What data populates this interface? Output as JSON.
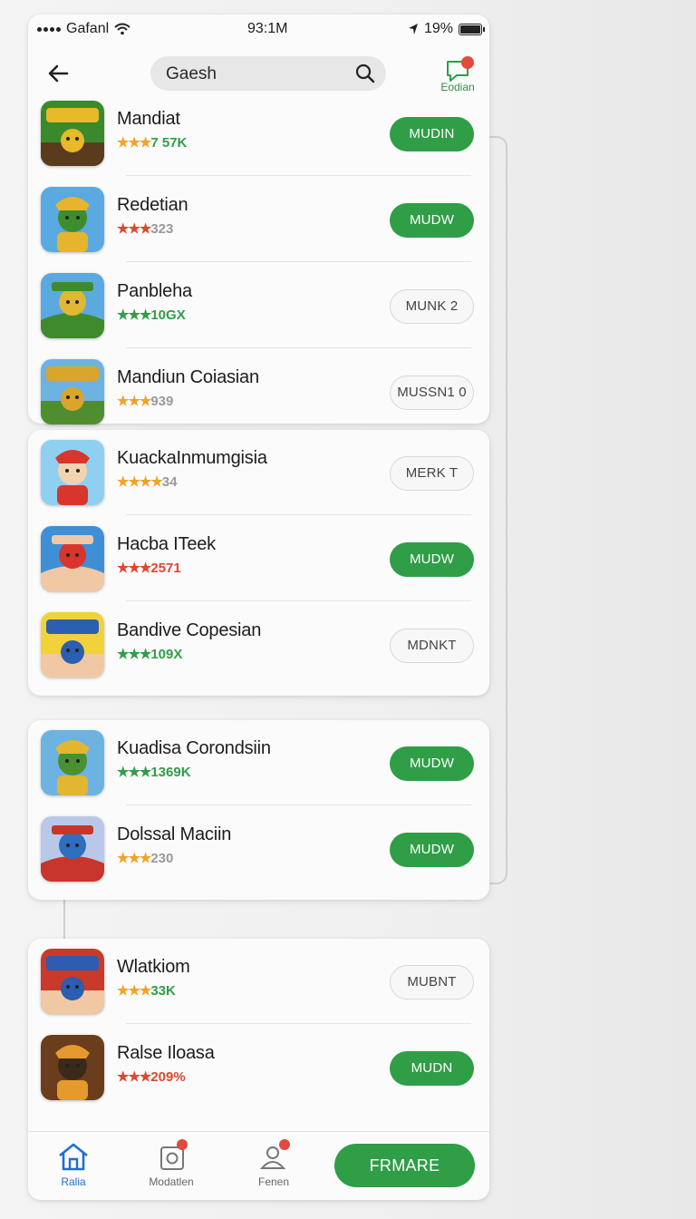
{
  "status_bar": {
    "carrier": "Gafanl",
    "time": "93:1M",
    "battery": "19%"
  },
  "header": {
    "search_text": "Gaesh",
    "notify_label": "Eodian"
  },
  "apps": [
    {
      "name": "Mandiat",
      "stars": "★★★",
      "count": "7 57K",
      "button": "MUDIN",
      "button_style": "green",
      "star_color": "#f0a32a",
      "count_color": "#2f9e46",
      "icon_colors": [
        "#3a8a2c",
        "#e8b928",
        "#5b3b1e"
      ]
    },
    {
      "name": "Redetian",
      "stars": "★★★",
      "count": "323",
      "button": "MUDW",
      "button_style": "green",
      "star_color": "#e0472f",
      "count_color": "#9a9a9a",
      "icon_colors": [
        "#5aa9e0",
        "#e6b52c",
        "#3e8d2d"
      ]
    },
    {
      "name": "Panbleha",
      "stars": "★★★",
      "count": "10GX",
      "button": "MUNK 2",
      "button_style": "outline",
      "star_color": "#2f9e46",
      "count_color": "#2f9e46",
      "icon_colors": [
        "#5aa9e0",
        "#e0b833",
        "#3f8a2c"
      ]
    },
    {
      "name": "Mandiun Coiasian",
      "stars": "★★★",
      "count": "939",
      "button": "MUSSN1 0",
      "button_style": "outline",
      "star_color": "#f0a32a",
      "count_color": "#9a9a9a",
      "icon_colors": [
        "#6cb3e2",
        "#d9a52b",
        "#4f8e30"
      ]
    },
    {
      "name": "KuackaInmumgisia",
      "stars": "★★★★",
      "count": "34",
      "button": "MERK T",
      "button_style": "outline",
      "star_color": "#f0a32a",
      "count_color": "#9a9a9a",
      "icon_colors": [
        "#8fd0f0",
        "#d8362d",
        "#f2d3b0"
      ]
    },
    {
      "name": "Hacba ITeek",
      "stars": "★★★",
      "count": "2571",
      "button": "MUDW",
      "button_style": "green",
      "star_color": "#e0472f",
      "count_color": "#e0472f",
      "icon_colors": [
        "#3f8fd6",
        "#d8362d",
        "#f0c9a4"
      ]
    },
    {
      "name": "Bandive Copesian",
      "stars": "★★★",
      "count": "109X",
      "button": "MDNKT",
      "button_style": "outline",
      "star_color": "#2f9e46",
      "count_color": "#2f9e46",
      "icon_colors": [
        "#f2d23a",
        "#2b5fb0",
        "#f0c9a4"
      ]
    },
    {
      "name": "Kuadisa Corondsiin",
      "stars": "★★★",
      "count": "1369K",
      "button": "MUDW",
      "button_style": "green",
      "star_color": "#2f9e46",
      "count_color": "#2f9e46",
      "icon_colors": [
        "#6cb3e2",
        "#e1b630",
        "#4a9032"
      ]
    },
    {
      "name": "Dolssal Maciin",
      "stars": "★★★",
      "count": "230",
      "button": "MUDW",
      "button_style": "green",
      "star_color": "#f0a32a",
      "count_color": "#9a9a9a",
      "icon_colors": [
        "#b9c8e8",
        "#2d6fc0",
        "#c8352c"
      ]
    },
    {
      "name": "Wlatkiom",
      "stars": "★★★",
      "count": "33K",
      "button": "MUBNT",
      "button_style": "outline",
      "star_color": "#f0a32a",
      "count_color": "#2f9e46",
      "icon_colors": [
        "#c83a2a",
        "#2d5cb0",
        "#f0c9a4"
      ]
    },
    {
      "name": "Ralse Iloasa",
      "stars": "★★★",
      "count": "209%",
      "button": "MUDN",
      "button_style": "green",
      "star_color": "#e0472f",
      "count_color": "#e0472f",
      "icon_colors": [
        "#6a3d1c",
        "#e69a2e",
        "#3b2a1a"
      ]
    }
  ],
  "tabbar": {
    "tabs": [
      {
        "label": "Ralia",
        "active": true
      },
      {
        "label": "Modatlen",
        "active": false
      },
      {
        "label": "Fenen",
        "active": false
      }
    ],
    "primary_label": "FRMARE"
  },
  "colors": {
    "accent": "#2f9e46",
    "badge": "#e04a3f",
    "active_tab": "#1f6fd1"
  }
}
